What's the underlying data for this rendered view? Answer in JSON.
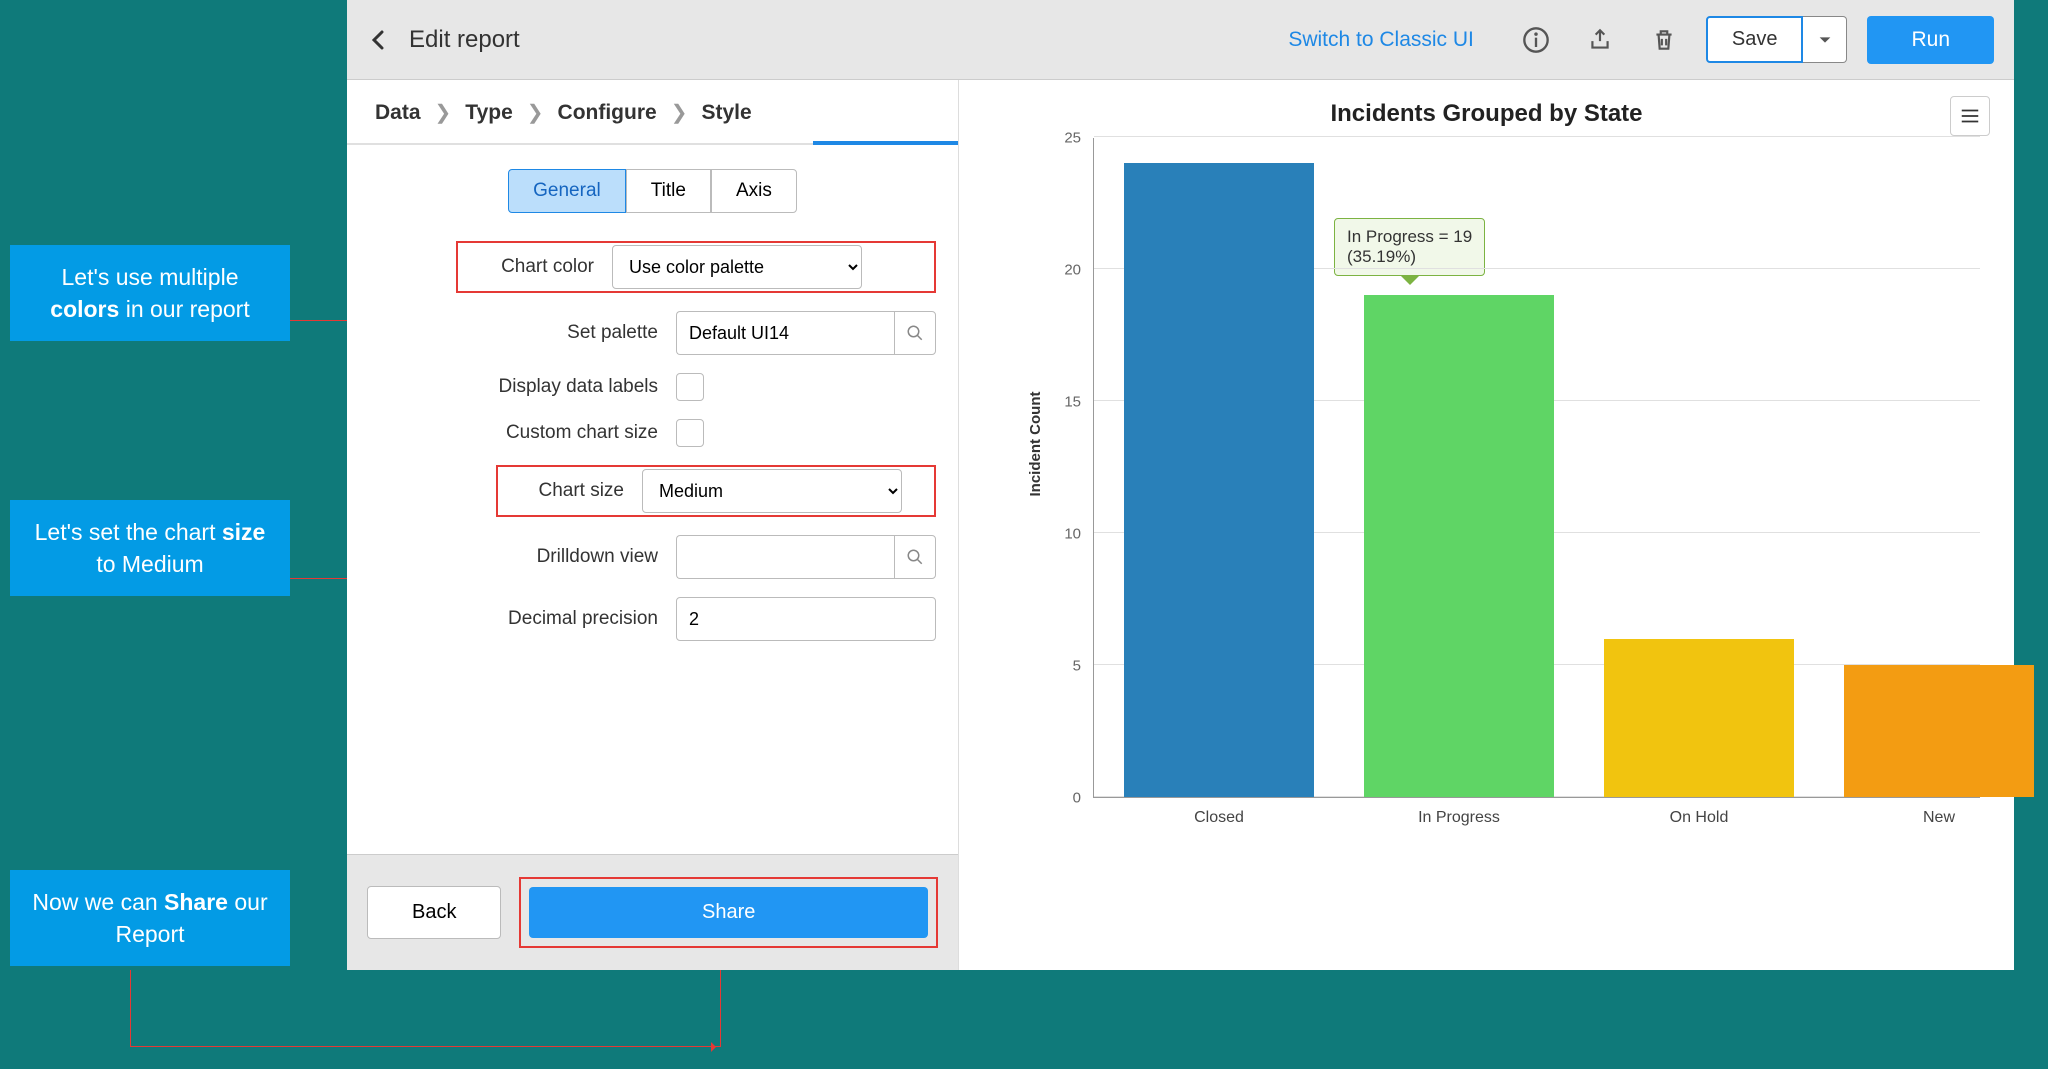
{
  "topbar": {
    "title": "Edit report",
    "classic_link": "Switch to Classic UI",
    "save": "Save",
    "run": "Run"
  },
  "breadcrumb": [
    "Data",
    "Type",
    "Configure",
    "Style"
  ],
  "tabs": [
    "General",
    "Title",
    "Axis"
  ],
  "form": {
    "chart_color_label": "Chart color",
    "chart_color_value": "Use color palette",
    "set_palette_label": "Set palette",
    "set_palette_value": "Default UI14",
    "display_labels_label": "Display data labels",
    "custom_size_label": "Custom chart size",
    "chart_size_label": "Chart size",
    "chart_size_value": "Medium",
    "drilldown_label": "Drilldown view",
    "drilldown_value": "",
    "decimal_label": "Decimal precision",
    "decimal_value": "2"
  },
  "buttons": {
    "back": "Back",
    "share": "Share"
  },
  "chart_data": {
    "type": "bar",
    "title": "Incidents Grouped by State",
    "ylabel": "Incident Count",
    "xlabel": "",
    "categories": [
      "Closed",
      "In Progress",
      "On Hold",
      "New"
    ],
    "values": [
      24,
      19,
      6,
      5
    ],
    "colors": [
      "#2980b9",
      "#5fd565",
      "#f1c40f",
      "#f39c12"
    ],
    "ylim": [
      0,
      25
    ],
    "yticks": [
      0,
      5,
      10,
      15,
      20,
      25
    ],
    "tooltip": {
      "line1": "In Progress = 19",
      "line2": "(35.19%)"
    }
  },
  "callouts": {
    "c1a": "Let's use multiple",
    "c1b": "colors",
    "c1c": " in our report",
    "c2a": "Let's set the chart ",
    "c2b": "size",
    "c2c": " to Medium",
    "c3a": "Now we can ",
    "c3b": "Share",
    "c3c": " our Report"
  }
}
